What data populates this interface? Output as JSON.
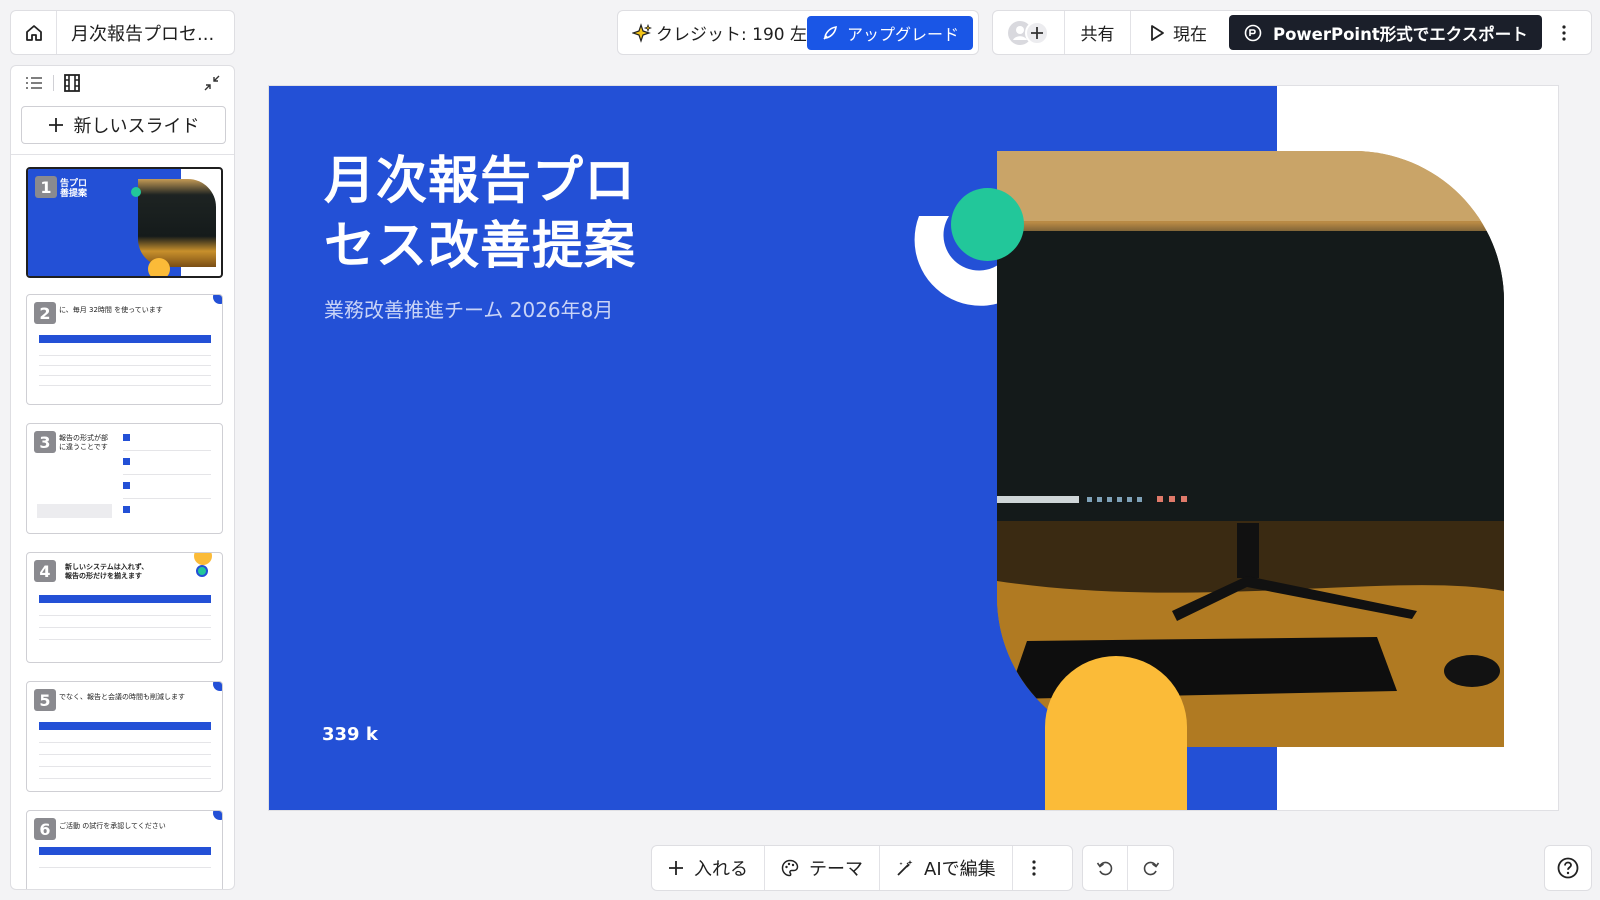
{
  "header": {
    "doc_title": "月次報告プロセ...",
    "credits": "クレジット: 190 左",
    "upgrade": "アップグレード",
    "share": "共有",
    "present": "現在",
    "export": "PowerPoint形式でエクスポート"
  },
  "sidebar": {
    "new_slide": "新しいスライド",
    "thumbnails": [
      {
        "number": "1",
        "title": "告プロ\n善提案"
      },
      {
        "number": "2",
        "title": "に、毎月 32時間 を使っています"
      },
      {
        "number": "3",
        "title": "報告の形式が部\nに違うことです"
      },
      {
        "number": "4",
        "title": "新しいシステムは入れず、\n報告の形だけを揃えます"
      },
      {
        "number": "5",
        "title": "でなく、報告と会議の時間も削減します"
      },
      {
        "number": "6",
        "title": "ご活動 の試行を承認してください"
      }
    ]
  },
  "slide": {
    "title": "月次報告プロセス改善提案",
    "subtitle": "業務改善推進チーム 2026年8月",
    "footer": "339 k"
  },
  "toolbar": {
    "insert": "入れる",
    "theme": "テーマ",
    "ai_edit": "AIで編集"
  },
  "colors": {
    "slide_blue": "#2350d6",
    "accent_green": "#22c79a",
    "accent_yellow": "#fbbb38",
    "upgrade_blue": "#1a56e6",
    "export_dark": "#1b1f2a"
  }
}
